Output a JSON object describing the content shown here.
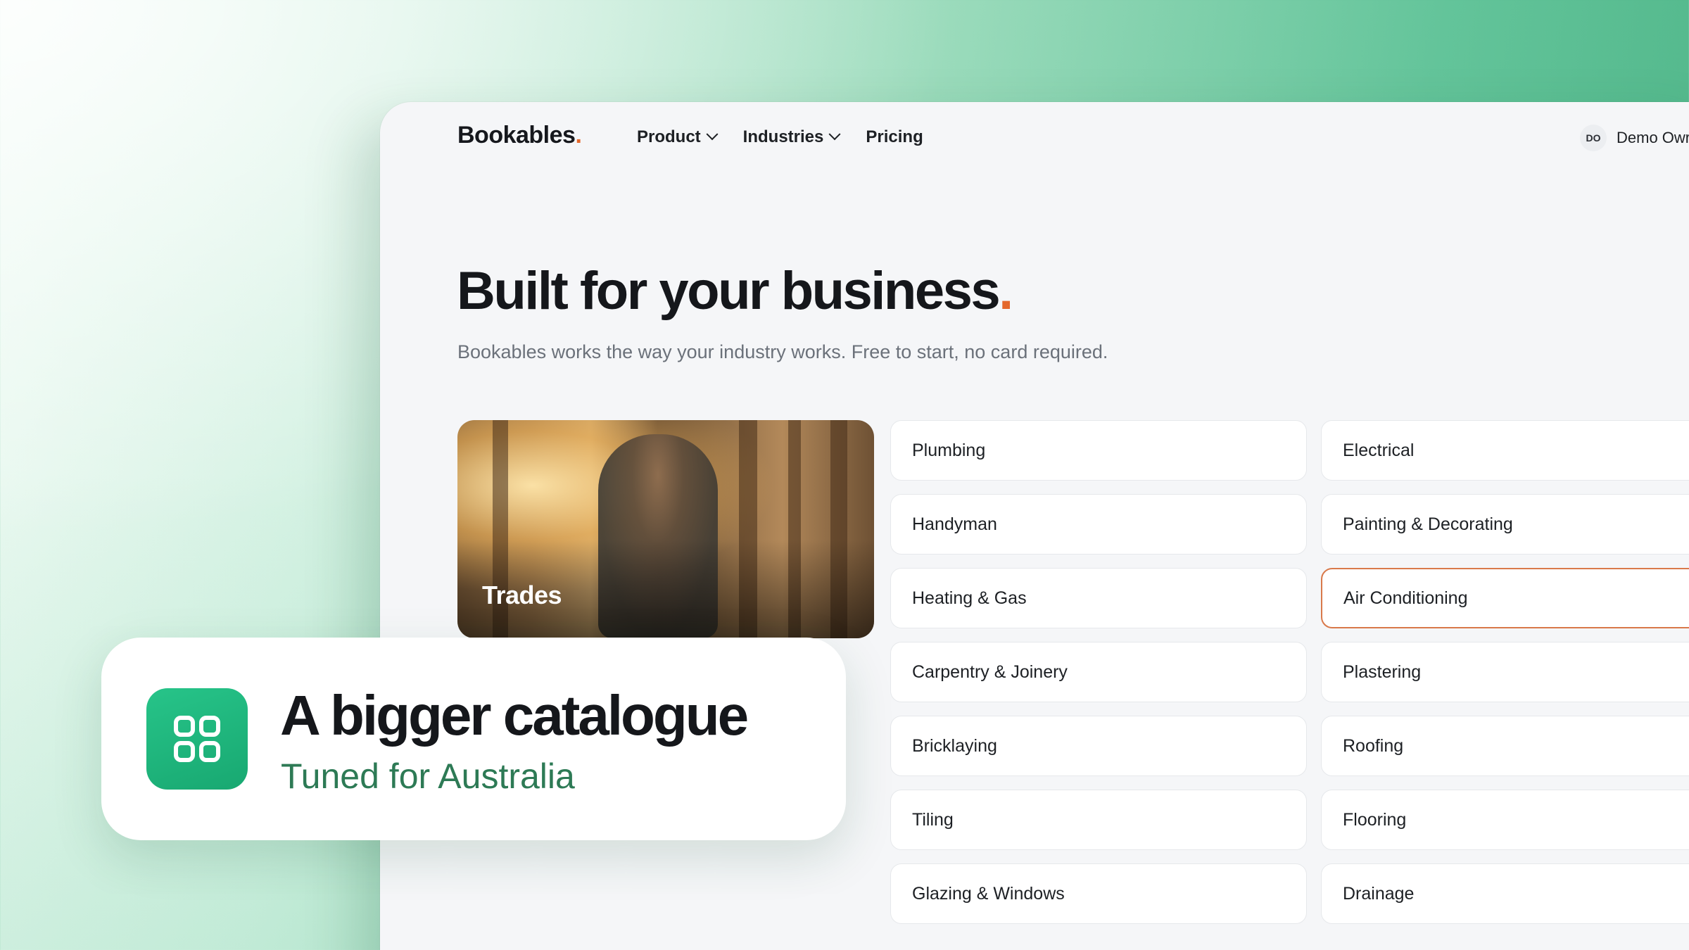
{
  "nav": {
    "logo_text": "Bookables",
    "logo_dot": ".",
    "items": [
      {
        "label": "Product",
        "has_dropdown": true
      },
      {
        "label": "Industries",
        "has_dropdown": true
      },
      {
        "label": "Pricing",
        "has_dropdown": false
      }
    ],
    "user": {
      "initials": "DO",
      "name": "Demo Owr"
    }
  },
  "hero": {
    "title": "Built for your business",
    "title_dot": ".",
    "subtitle": "Bookables works the way your industry works. Free to start, no card required."
  },
  "feature_card": {
    "label": "Trades"
  },
  "categories": [
    {
      "label": "Plumbing",
      "active": false
    },
    {
      "label": "Electrical",
      "active": false
    },
    {
      "label": "Handyman",
      "active": false
    },
    {
      "label": "Painting & Decorating",
      "active": false
    },
    {
      "label": "Heating & Gas",
      "active": false
    },
    {
      "label": "Air Conditioning",
      "active": true
    },
    {
      "label": "Carpentry & Joinery",
      "active": false
    },
    {
      "label": "Plastering",
      "active": false
    },
    {
      "label": "Bricklaying",
      "active": false
    },
    {
      "label": "Roofing",
      "active": false
    },
    {
      "label": "Tiling",
      "active": false
    },
    {
      "label": "Flooring",
      "active": false
    },
    {
      "label": "Glazing & Windows",
      "active": false
    },
    {
      "label": "Drainage",
      "active": false
    }
  ],
  "callout": {
    "icon": "grid-icon",
    "title": "A bigger catalogue",
    "subtitle": "Tuned for Australia"
  },
  "colors": {
    "accent_orange": "#e4682c",
    "brand_green": "#1fb57d",
    "subtitle_green": "#2d7a55"
  }
}
